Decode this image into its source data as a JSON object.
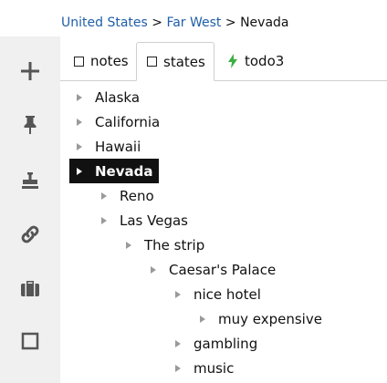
{
  "breadcrumb": {
    "items": [
      "United States",
      "Far West"
    ],
    "separator": ">",
    "current": "Nevada"
  },
  "sidebar": {
    "icons": [
      "plus-icon",
      "pin-icon",
      "stamp-icon",
      "link-icon",
      "briefcase-icon",
      "square-icon"
    ]
  },
  "tabs": [
    {
      "label": "notes",
      "icon": "square-icon",
      "active": false
    },
    {
      "label": "states",
      "icon": "square-icon",
      "active": true
    },
    {
      "label": "todo3",
      "icon": "bolt-icon",
      "active": false
    }
  ],
  "tree": [
    {
      "label": "Alaska",
      "depth": 0,
      "selected": false
    },
    {
      "label": "California",
      "depth": 0,
      "selected": false
    },
    {
      "label": "Hawaii",
      "depth": 0,
      "selected": false
    },
    {
      "label": "Nevada",
      "depth": 0,
      "selected": true
    },
    {
      "label": "Reno",
      "depth": 1,
      "selected": false
    },
    {
      "label": "Las Vegas",
      "depth": 1,
      "selected": false
    },
    {
      "label": "The strip",
      "depth": 2,
      "selected": false
    },
    {
      "label": "Caesar's Palace",
      "depth": 3,
      "selected": false
    },
    {
      "label": "nice hotel",
      "depth": 4,
      "selected": false
    },
    {
      "label": "muy expensive",
      "depth": 5,
      "selected": false
    },
    {
      "label": "gambling",
      "depth": 4,
      "selected": false
    },
    {
      "label": "music",
      "depth": 4,
      "selected": false
    }
  ],
  "colors": {
    "link": "#1f5fa8",
    "selected_bg": "#111111",
    "sidebar_bg": "#f0f0f0",
    "bolt": "#3cb043"
  }
}
